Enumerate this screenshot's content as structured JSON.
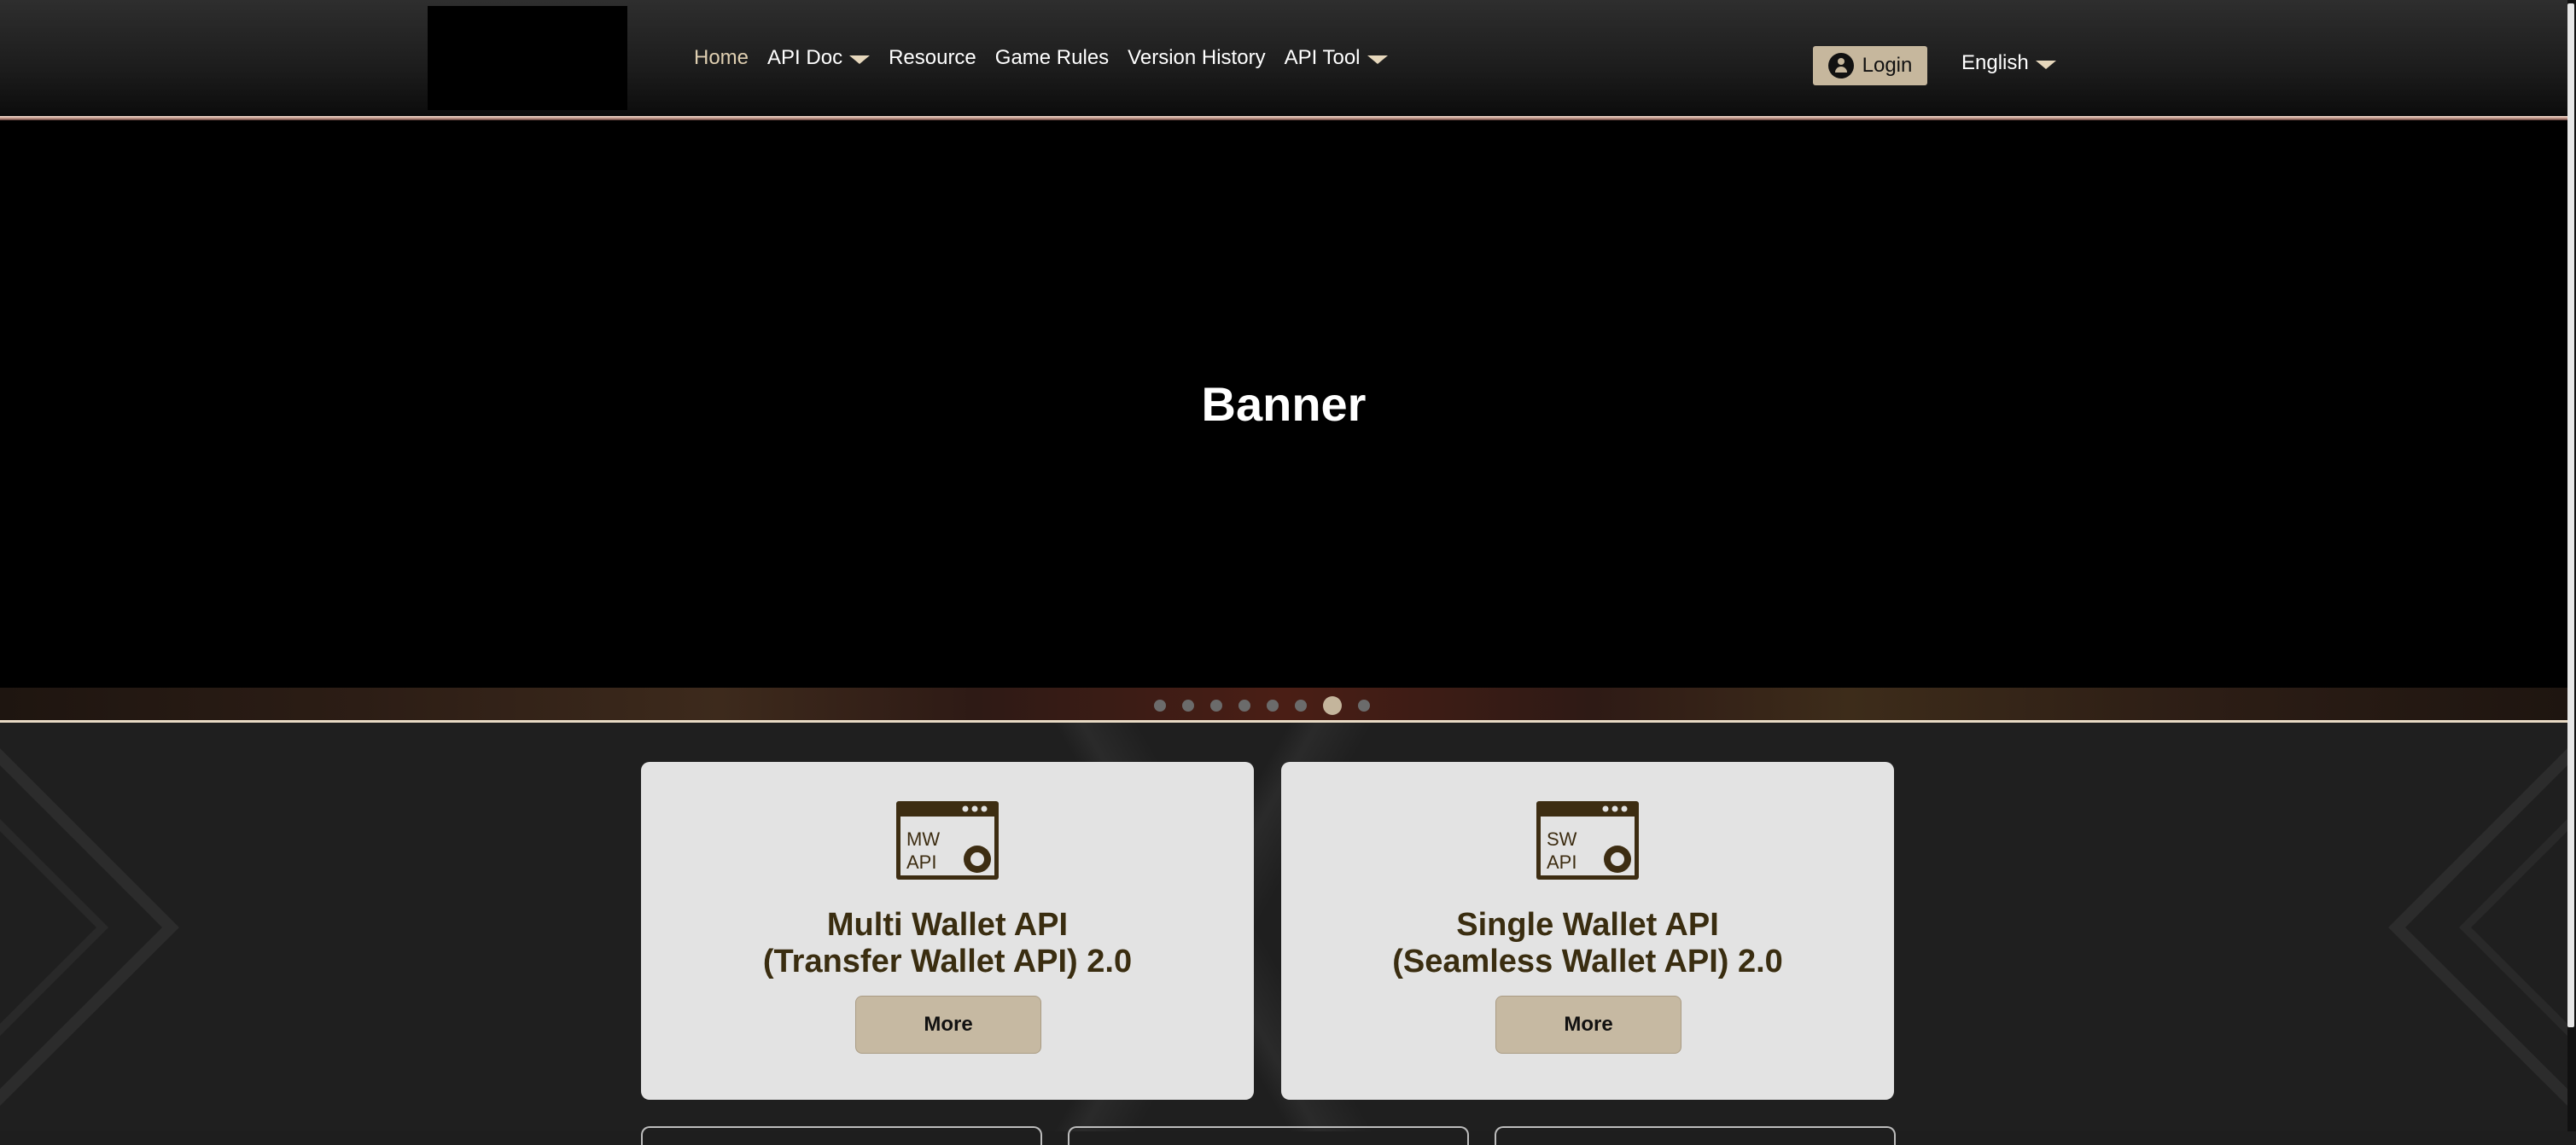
{
  "header": {
    "nav": [
      {
        "label": "Home",
        "active": true,
        "dropdown": false
      },
      {
        "label": "API Doc",
        "active": false,
        "dropdown": true
      },
      {
        "label": "Resource",
        "active": false,
        "dropdown": false
      },
      {
        "label": "Game Rules",
        "active": false,
        "dropdown": false
      },
      {
        "label": "Version History",
        "active": false,
        "dropdown": false
      },
      {
        "label": "API Tool",
        "active": false,
        "dropdown": true
      }
    ],
    "login_label": "Login",
    "language": "English"
  },
  "banner": {
    "title": "Banner",
    "slide_count": 8,
    "active_slide": 7
  },
  "cards": [
    {
      "icon_label": [
        "MW",
        "API"
      ],
      "title_line1": "Multi Wallet API",
      "title_line2": "(Transfer Wallet API) 2.0",
      "button": "More"
    },
    {
      "icon_label": [
        "SW",
        "API"
      ],
      "title_line1": "Single Wallet API",
      "title_line2": "(Seamless Wallet API) 2.0",
      "button": "More"
    }
  ],
  "colors": {
    "accent": "#c6b79d",
    "nav_active": "#dfcfb1",
    "card_bg": "#e3e3e3",
    "card_title": "#3a2d10",
    "icon_brown": "#3d2d12"
  }
}
